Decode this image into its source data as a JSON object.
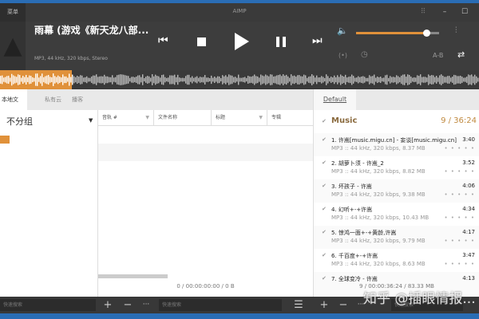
{
  "window": {
    "title": "AIMP",
    "menu_label": "菜单"
  },
  "player": {
    "track_title": "雨幕 (游戏《新天龙八部...",
    "track_info": "MP3, 44 kHz, 320 kbps, Stereo",
    "volume_percent": 80,
    "progress_percent": 15,
    "ab_label": "A-B"
  },
  "library": {
    "tabs": [
      "本地文件",
      "私有云",
      "播客"
    ],
    "group_label": "不分组",
    "columns": [
      "音轨 #",
      "文件名称",
      "标题",
      "专辑"
    ],
    "status": "0 / 00:00:00:00 / 0 B"
  },
  "playlist": {
    "tab": "Default",
    "name": "Music",
    "summary": "9 / 36:24",
    "items": [
      {
        "title": "1. 许嵩[music.migu.cn] - 妄谈[music.migu.cn]",
        "duration": "3:40",
        "info": "MP3 :: 44 kHz, 320 kbps, 8.37 MB"
      },
      {
        "title": "2. 胡萝卜须 - 许嵩_2",
        "duration": "3:52",
        "info": "MP3 :: 44 kHz, 320 kbps, 8.82 MB"
      },
      {
        "title": "3. 坏孩子 - 许嵩",
        "duration": "4:06",
        "info": "MP3 :: 44 kHz, 320 kbps, 9.38 MB"
      },
      {
        "title": "4. 幻听+-+许嵩",
        "duration": "4:34",
        "info": "MP3 :: 44 kHz, 320 kbps, 10.43 MB"
      },
      {
        "title": "5. 惊鸿一面+-+黄龄,许嵩",
        "duration": "4:17",
        "info": "MP3 :: 44 kHz, 320 kbps, 9.79 MB"
      },
      {
        "title": "6. 千百度+-+许嵩",
        "duration": "3:47",
        "info": "MP3 :: 44 kHz, 320 kbps, 8.63 MB"
      },
      {
        "title": "7. 全球变冷 - 许嵩",
        "duration": "4:13"
      }
    ],
    "status": "9 / 00:00:36:24 / 83.33 MB"
  },
  "bottom": {
    "search_placeholder": "快速搜索"
  },
  "watermark": "知乎 @插眼情报..."
}
